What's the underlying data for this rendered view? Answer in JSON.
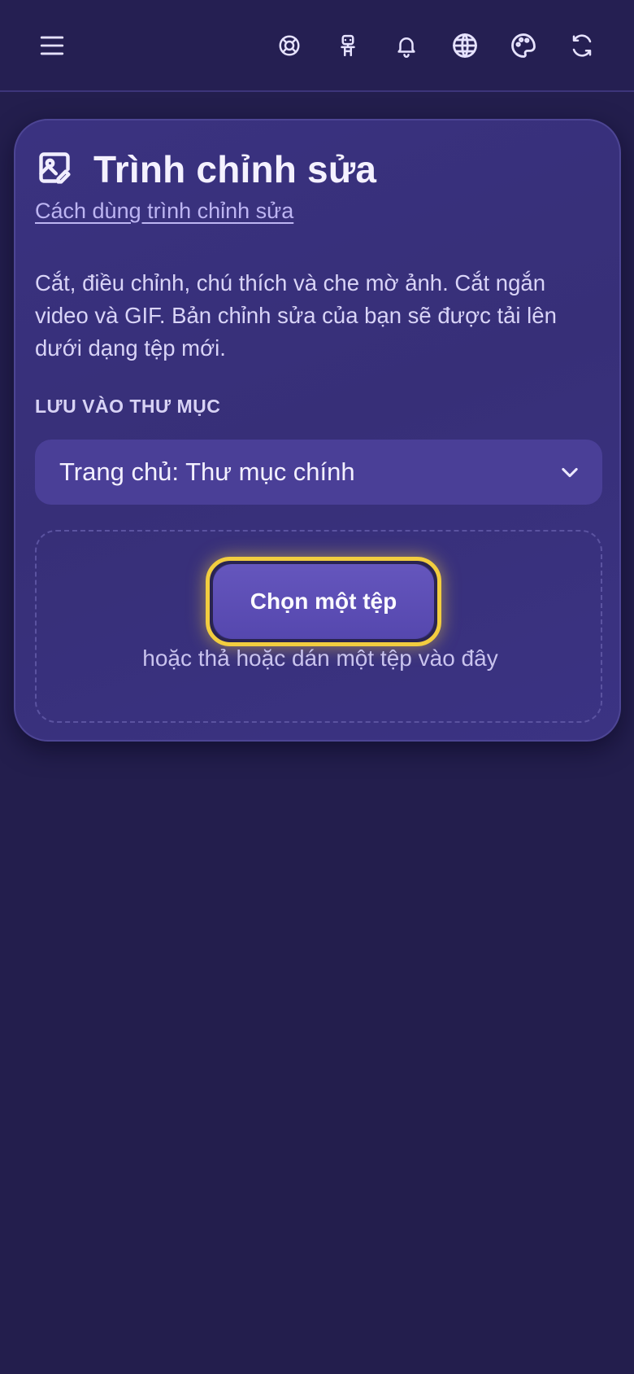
{
  "toolbar": {
    "icons": [
      "menu-icon",
      "help-buoy-icon",
      "robot-icon",
      "bell-icon",
      "globe-icon",
      "palette-icon",
      "refresh-icon"
    ]
  },
  "editor": {
    "title": "Trình chỉnh sửa",
    "help_link": "Cách dùng trình chỉnh sửa",
    "description": "Cắt, điều chỉnh, chú thích và che mờ ảnh. Cắt ngắn video và GIF. Bản chỉnh sửa của bạn sẽ được tải lên dưới dạng tệp mới.",
    "save_label": "LƯU VÀO THƯ MỤC",
    "folder_value": "Trang chủ: Thư mục chính",
    "choose_button": "Chọn một tệp",
    "drop_hint": "hoặc thả hoặc dán một tệp vào đây"
  },
  "colors": {
    "background": "#231e4d",
    "card": "#3a3280",
    "accent": "#5547ae",
    "focus_ring": "#f2cd3f"
  }
}
